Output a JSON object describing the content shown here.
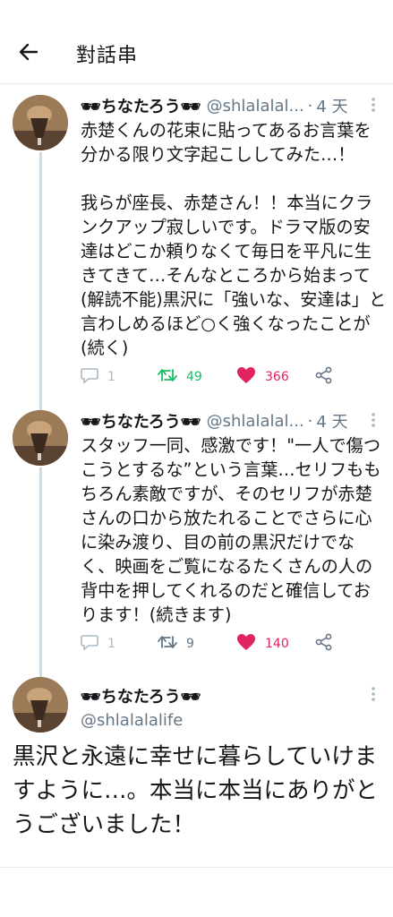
{
  "header": {
    "title": "對話串"
  },
  "tweets": [
    {
      "name": "🕶ちなたろう🕶",
      "handle": "@shlalalal...",
      "dot": "·",
      "time": "4 天",
      "body": "赤楚くんの花束に貼ってあるお言葉を分かる限り文字起こししてみた…！\n\n我らが座長、赤楚さん！！本当にクランクアップ寂しいです。ドラマ版の安達はどこか頼りなくて毎日を平凡に生きてきて…そんなところから始まって(解読不能)黒沢に「強いな、安達は」と言わしめるほど○く強くなったことが(続く)",
      "replies": "1",
      "retweets": "49",
      "likes": "366"
    },
    {
      "name": "🕶ちなたろう🕶",
      "handle": "@shlalalal...",
      "dot": "·",
      "time": "4 天",
      "body": "スタッフ一同、感激です！\"一人で傷つこうとするな”という言葉…セリフももちろん素敵ですが、そのセリフが赤楚さんの口から放たれることでさらに心に染み渡り、目の前の黒沢だけでなく、映画をご覧になるたくさんの人の背中を押してくれるのだと確信しております！(続きます)",
      "replies": "1",
      "retweets": "9",
      "likes": "140"
    }
  ],
  "focus": {
    "name": "🕶ちなたろう🕶",
    "handle": "@shlalalalife",
    "body": "黒沢と永遠に幸せに暮らしていけますように…。本当に本当にありがとうございました！"
  },
  "colors": {
    "retweet_active": "#17bf63",
    "like_active": "#e0245e",
    "muted": "#657786",
    "thread_line": "#cfd9de"
  },
  "icons": {
    "back": "back-arrow-icon",
    "caret": "more-vertical-icon",
    "reply": "reply-bubble-icon",
    "retweet": "retweet-icon",
    "like": "heart-icon",
    "share": "share-icon"
  }
}
